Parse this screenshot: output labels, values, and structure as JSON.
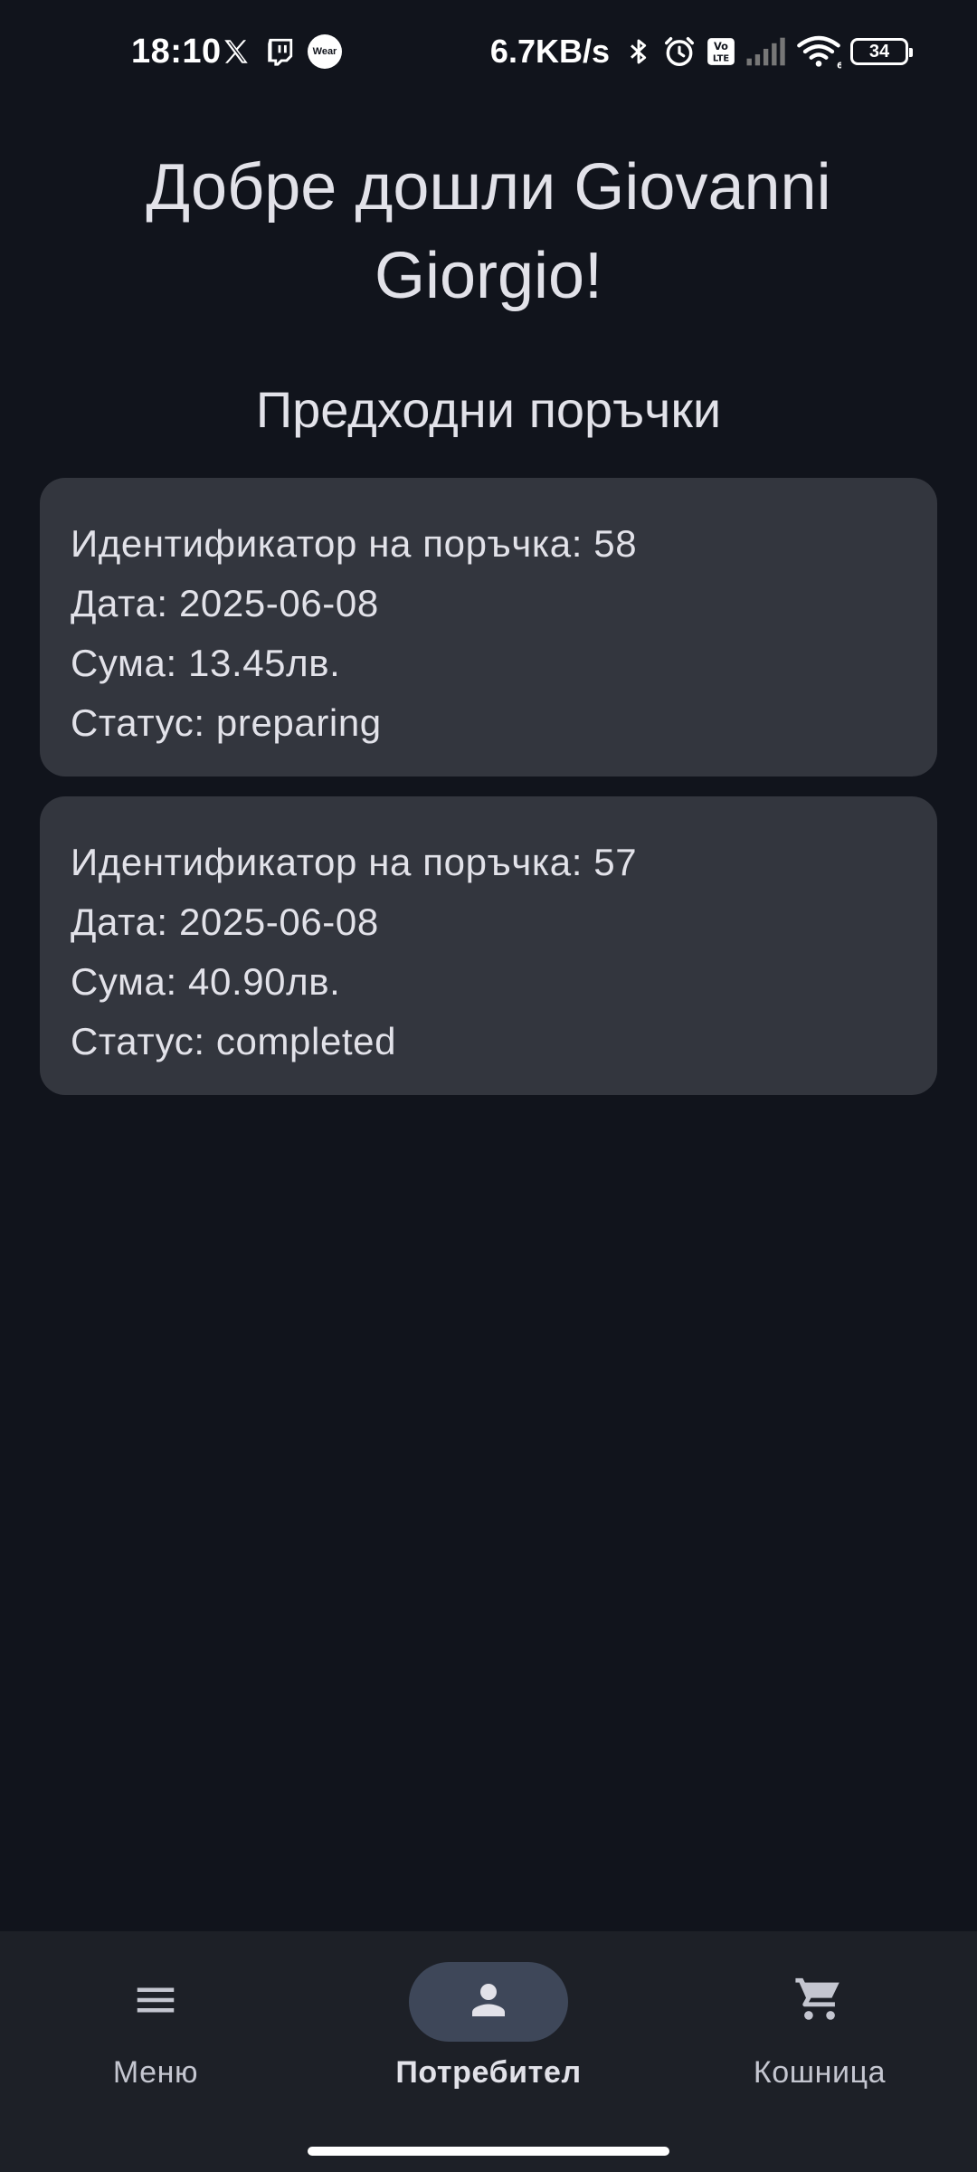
{
  "status_bar": {
    "time": "18:10",
    "network_speed": "6.7KB/s",
    "battery_level": "34",
    "wear_label": "Wear",
    "left_icons": [
      "x-icon",
      "twitch-icon",
      "wear-icon"
    ],
    "right_icons": [
      "bluetooth-icon",
      "alarm-icon",
      "volte-icon",
      "signal-icon",
      "wifi-icon",
      "battery-icon"
    ]
  },
  "header": {
    "welcome_text": "Добре дошли Giovanni Giorgio!"
  },
  "orders_section": {
    "title": "Предходни поръчки",
    "orders": [
      {
        "id_line": "Идентификатор на поръчка: 58",
        "date_line": "Дата: 2025-06-08",
        "sum_line": "Сума: 13.45лв.",
        "status_line": "Статус: preparing"
      },
      {
        "id_line": "Идентификатор на поръчка: 57",
        "date_line": "Дата: 2025-06-08",
        "sum_line": "Сума: 40.90лв.",
        "status_line": "Статус: completed"
      }
    ]
  },
  "bottom_nav": {
    "items": [
      {
        "label": "Меню",
        "icon": "menu-icon",
        "selected": false
      },
      {
        "label": "Потребител",
        "icon": "person-icon",
        "selected": true
      },
      {
        "label": "Кошница",
        "icon": "cart-icon",
        "selected": false
      }
    ]
  },
  "colors": {
    "background": "#11141c",
    "card": "#33363e",
    "nav_background": "#1d2027",
    "nav_selected_pill": "#3e4759",
    "text": "#e2e2e9"
  }
}
